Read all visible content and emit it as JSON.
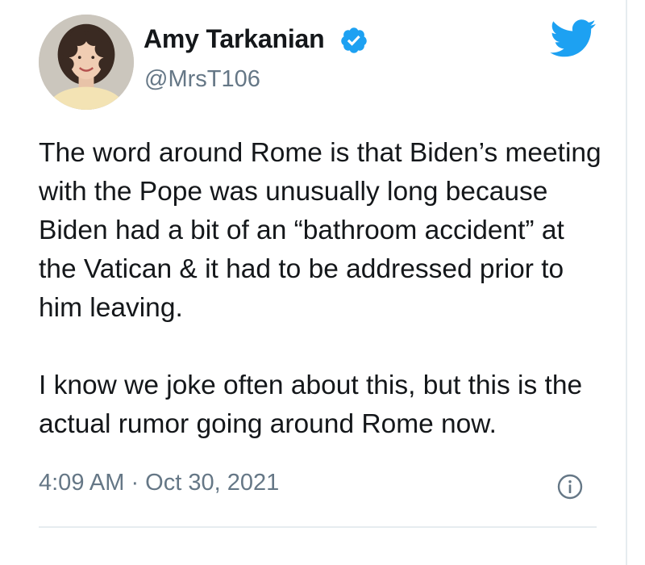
{
  "tweet": {
    "author": {
      "display_name": "Amy Tarkanian",
      "handle": "@MrsT106",
      "verified": true,
      "avatar_icon": "profile-photo"
    },
    "text": {
      "paragraph_1": "The word around Rome is that Biden’s meeting with the Pope was unusually long because Biden had a bit of an “bathroom accident” at the Vatican & it had to be addressed prior to him leaving.",
      "paragraph_2": "I know we joke often about this, but this is the actual rumor going around Rome now."
    },
    "timestamp": "4:09 AM · Oct 30, 2021",
    "icons": {
      "brand": "twitter-bird-icon",
      "verified": "verified-badge-icon",
      "info": "info-icon"
    }
  },
  "colors": {
    "twitter_blue": "#1da1f2",
    "text_primary": "#14171a",
    "text_secondary": "#657786",
    "divider": "#e6ecf0"
  }
}
